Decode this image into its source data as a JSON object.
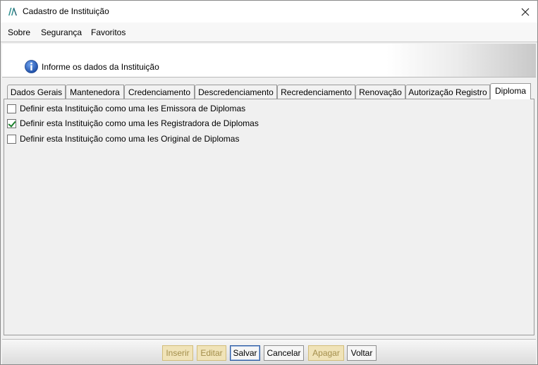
{
  "window": {
    "title": "Cadastro de Instituição"
  },
  "menu": {
    "items": [
      "Sobre",
      "Segurança",
      "Favoritos"
    ]
  },
  "header": {
    "text": "Informe os dados da Instituição"
  },
  "tabs": [
    {
      "label": "Dados Gerais",
      "active": false
    },
    {
      "label": "Mantenedora",
      "active": false
    },
    {
      "label": "Credenciamento",
      "active": false
    },
    {
      "label": "Descredenciamento",
      "active": false
    },
    {
      "label": "Recredenciamento",
      "active": false
    },
    {
      "label": "Renovação",
      "active": false
    },
    {
      "label": "Autorização Registro",
      "active": false
    },
    {
      "label": "Diploma",
      "active": true
    }
  ],
  "diploma": {
    "options": [
      {
        "label": "Definir esta Instituição como uma Ies Emissora de Diplomas",
        "checked": false
      },
      {
        "label": "Definir esta Instituição como uma Ies Registradora de Diplomas",
        "checked": true
      },
      {
        "label": "Definir esta Instituição como uma Ies Original de Diplomas",
        "checked": false
      }
    ]
  },
  "buttons": [
    {
      "label": "Inserir",
      "enabled": false
    },
    {
      "label": "Editar",
      "enabled": false
    },
    {
      "label": "Salvar",
      "enabled": true
    },
    {
      "label": "Cancelar",
      "enabled": true
    },
    {
      "label": "Apagar",
      "enabled": false
    },
    {
      "label": "Voltar",
      "enabled": true
    }
  ],
  "colors": {
    "check": "#1a7f2a",
    "disabled_button_bg": "#f0e3b8",
    "info_icon": "#1f5fbf",
    "app_logo": "#2a8c8c"
  }
}
